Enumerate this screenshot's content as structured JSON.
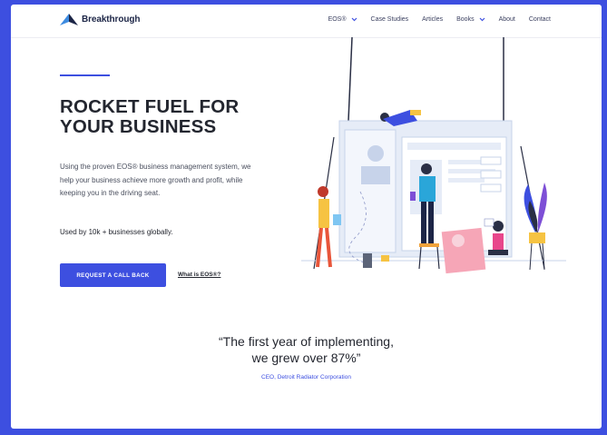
{
  "brand": {
    "name": "Breakthrough"
  },
  "nav": {
    "items": [
      {
        "label": "EOS®",
        "has_dropdown": true
      },
      {
        "label": "Case Studies",
        "has_dropdown": false
      },
      {
        "label": "Articles",
        "has_dropdown": false
      },
      {
        "label": "Books",
        "has_dropdown": true
      },
      {
        "label": "About",
        "has_dropdown": false
      },
      {
        "label": "Contact",
        "has_dropdown": false
      }
    ]
  },
  "hero": {
    "headline_line1": "ROCKET FUEL FOR",
    "headline_line2": "YOUR BUSINESS",
    "description": "Using the proven EOS® business management system, we help your business achieve more growth and profit, while keeping you in the driving seat.",
    "social_proof": "Used by 10k + businesses globally.",
    "cta_label": "REQUEST A CALL BACK",
    "secondary_link": "What is EOS®?"
  },
  "testimonial": {
    "quote_line1": "“The first year of implementing,",
    "quote_line2": "we grew over 87%”",
    "author": "CEO, Detroit Radiator Corporation"
  },
  "colors": {
    "accent": "#3d4fe0",
    "text_dark": "#23262f",
    "background": "#ffffff"
  }
}
